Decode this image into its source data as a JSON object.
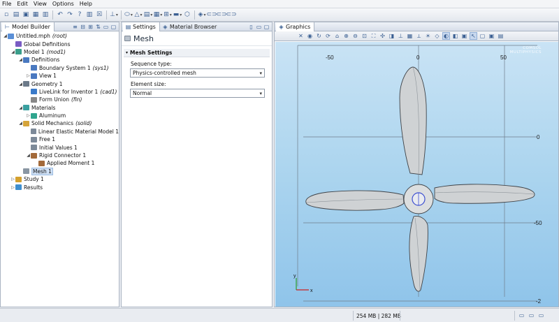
{
  "menu": [
    "File",
    "Edit",
    "View",
    "Options",
    "Help"
  ],
  "toolbar_icons": [
    "new-icon",
    "open-icon",
    "save-icon",
    "save-all-icon",
    "print-icon",
    "undo-icon",
    "redo-icon",
    "help-icon",
    "measure-icon",
    "close-icon",
    "geometry-icon",
    "selection-icon",
    "definition-icon",
    "mesh-icon",
    "physics-icon",
    "material-icon",
    "study-icon",
    "results-icon",
    "view-icon",
    "link-icon"
  ],
  "model_builder": {
    "title": "Model Builder",
    "tree": [
      {
        "label": "Untitled.mph",
        "tag": "(root)",
        "depth": 0,
        "expanded": true,
        "icon": "file"
      },
      {
        "label": "Global Definitions",
        "tag": "",
        "depth": 1,
        "expanded": null,
        "icon": "global"
      },
      {
        "label": "Model 1",
        "tag": "(mod1)",
        "depth": 1,
        "expanded": true,
        "icon": "model"
      },
      {
        "label": "Definitions",
        "tag": "",
        "depth": 2,
        "expanded": true,
        "icon": "definitions"
      },
      {
        "label": "Boundary System 1",
        "tag": "(sys1)",
        "depth": 3,
        "expanded": null,
        "icon": "coordsys"
      },
      {
        "label": "View 1",
        "tag": "",
        "depth": 3,
        "expanded": false,
        "icon": "view"
      },
      {
        "label": "Geometry 1",
        "tag": "",
        "depth": 2,
        "expanded": true,
        "icon": "geometry"
      },
      {
        "label": "LiveLink for Inventor 1",
        "tag": "(cad1)",
        "depth": 3,
        "expanded": null,
        "icon": "livelink"
      },
      {
        "label": "Form Union",
        "tag": "(fin)",
        "depth": 3,
        "expanded": null,
        "icon": "form-union"
      },
      {
        "label": "Materials",
        "tag": "",
        "depth": 2,
        "expanded": true,
        "icon": "materials"
      },
      {
        "label": "Aluminum",
        "tag": "",
        "depth": 3,
        "expanded": false,
        "icon": "material"
      },
      {
        "label": "Solid Mechanics",
        "tag": "(solid)",
        "depth": 2,
        "expanded": true,
        "icon": "solid"
      },
      {
        "label": "Linear Elastic Material Model 1",
        "tag": "",
        "depth": 3,
        "expanded": null,
        "icon": "elastic"
      },
      {
        "label": "Free 1",
        "tag": "",
        "depth": 3,
        "expanded": null,
        "icon": "free"
      },
      {
        "label": "Initial Values 1",
        "tag": "",
        "depth": 3,
        "expanded": null,
        "icon": "initial"
      },
      {
        "label": "Rigid Connector 1",
        "tag": "",
        "depth": 3,
        "expanded": true,
        "icon": "rigid"
      },
      {
        "label": "Applied Moment 1",
        "tag": "",
        "depth": 4,
        "expanded": null,
        "icon": "moment"
      },
      {
        "label": "Mesh 1",
        "tag": "",
        "depth": 2,
        "expanded": null,
        "icon": "mesh",
        "selected": true
      },
      {
        "label": "Study 1",
        "tag": "",
        "depth": 1,
        "expanded": false,
        "icon": "study"
      },
      {
        "label": "Results",
        "tag": "",
        "depth": 1,
        "expanded": false,
        "icon": "results"
      }
    ]
  },
  "settings": {
    "tabs": [
      "Settings",
      "Material Browser"
    ],
    "title": "Mesh",
    "section": "Mesh Settings",
    "sequence_label": "Sequence type:",
    "sequence_value": "Physics-controlled mesh",
    "element_label": "Element size:",
    "element_value": "Normal"
  },
  "graphics": {
    "title": "Graphics",
    "axis_labels": {
      "top_left": "-50",
      "top_mid": "0",
      "top_right": "50",
      "right_top": "0",
      "right_bottom": "-50",
      "bottom_right": "-2"
    },
    "triad": {
      "y": "y",
      "x": "x"
    },
    "logo": [
      "COMSOL",
      "MULTIPHYSICS"
    ]
  },
  "status": {
    "memory": "254 MB | 282 MB"
  }
}
